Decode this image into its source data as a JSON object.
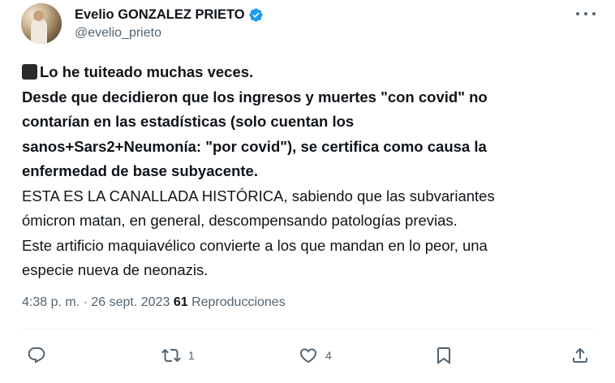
{
  "tweet": {
    "author": {
      "display_name": "Evelio GONZALEZ PRIETO",
      "handle": "@evelio_prieto",
      "verified_icon": "verified-badge-icon",
      "verified_color": "#1d9bf0"
    },
    "body": {
      "bold_lines": [
        "Lo he tuiteado muchas veces.",
        "Desde que decidieron que los ingresos y muertes \"con covid\" no",
        "contarían en las estadísticas (solo cuentan los",
        "sanos+Sars2+Neumonía: \"por covid\"), se certifica como causa la",
        "enfermedad de base subyacente."
      ],
      "normal_lines": [
        "ESTA ES LA CANALLADA HISTÓRICA, sabiendo que las subvariantes",
        "ómicron matan, en general, descompensando patologías previas.",
        "Este artificio maquiavélico convierte a los que mandan en lo peor, una",
        "especie nueva de neonazis."
      ],
      "lead_emoji": "black-square-emoji"
    },
    "meta": {
      "time": "4:38 p. m.",
      "separator": "·",
      "date": "26 sept. 2023",
      "separator2": "·",
      "views_count": "61",
      "views_label": "Reproducciones"
    },
    "actions": {
      "reply": {
        "icon": "reply-icon",
        "count": ""
      },
      "retweet": {
        "icon": "retweet-icon",
        "count": "1"
      },
      "like": {
        "icon": "heart-icon",
        "count": "4"
      },
      "bookmark": {
        "icon": "bookmark-icon",
        "count": ""
      },
      "share": {
        "icon": "share-icon",
        "count": ""
      }
    },
    "colors": {
      "text": "#0f1419",
      "secondary": "#536471",
      "accent": "#1d9bf0"
    }
  }
}
